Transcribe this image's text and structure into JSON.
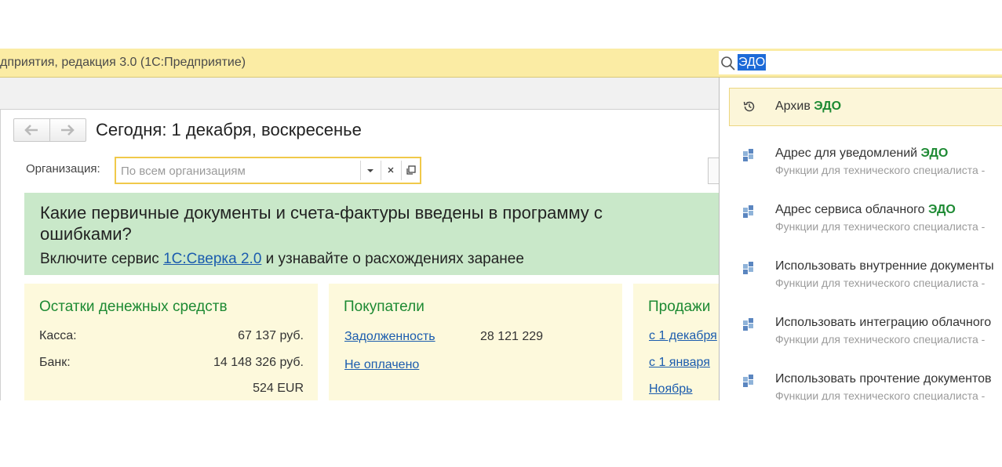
{
  "titlebar": {
    "title": "дприятия, редакция 3.0  (1С:Предприятие)"
  },
  "search": {
    "query": "ЭДО"
  },
  "page": {
    "today": "Сегодня: 1 декабря, воскресенье",
    "org_label": "Организация:",
    "org_placeholder": "По всем организациям"
  },
  "banner": {
    "heading": "Какие первичные документы и счета-фактуры введены в программу с ошибками?",
    "text_before": "Включите сервис ",
    "link": "1С:Сверка 2.0",
    "text_after": " и узнавайте о расхождениях заранее"
  },
  "cards": {
    "cash": {
      "title": "Остатки денежных средств",
      "rows": [
        {
          "label": "Касса:",
          "value": "67 137 руб."
        },
        {
          "label": "Банк:",
          "value": "14 148 326 руб."
        },
        {
          "label": "",
          "value": "524 EUR"
        }
      ]
    },
    "buyers": {
      "title": "Покупатели",
      "debt_link": "Задолженность",
      "debt_value": "28 121 229",
      "unpaid_link": "Не оплачено"
    },
    "sales": {
      "title": "Продажи",
      "links": [
        "с 1 декабря",
        "с 1 января",
        "Ноябрь"
      ]
    }
  },
  "dropdown": {
    "items": [
      {
        "title_prefix": "Архив ",
        "highlight": "ЭДО",
        "subtitle": "",
        "icon": "history-icon"
      },
      {
        "title_prefix": "Адрес для уведомлений ",
        "highlight": "ЭДО",
        "subtitle": "Функции для технического специалиста -",
        "icon": "function-icon"
      },
      {
        "title_prefix": "Адрес сервиса облачного ",
        "highlight": "ЭДО",
        "subtitle": "Функции для технического специалиста -",
        "icon": "function-icon"
      },
      {
        "title_prefix": "Использовать внутренние документы",
        "highlight": "",
        "subtitle": "Функции для технического специалиста -",
        "icon": "function-icon"
      },
      {
        "title_prefix": "Использовать интеграцию облачного",
        "highlight": "",
        "subtitle": "Функции для технического специалиста -",
        "icon": "function-icon"
      },
      {
        "title_prefix": "Использовать прочтение документов",
        "highlight": "",
        "subtitle": "Функции для технического специалиста -",
        "icon": "function-icon"
      }
    ]
  },
  "colors": {
    "accent_green": "#1d8a33",
    "title_yellow": "#fbeca4",
    "banner_green": "#c9e8c9",
    "card_yellow": "#fdf9dc",
    "link_blue": "#1b5cae",
    "selection_blue": "#1c6ad8"
  }
}
